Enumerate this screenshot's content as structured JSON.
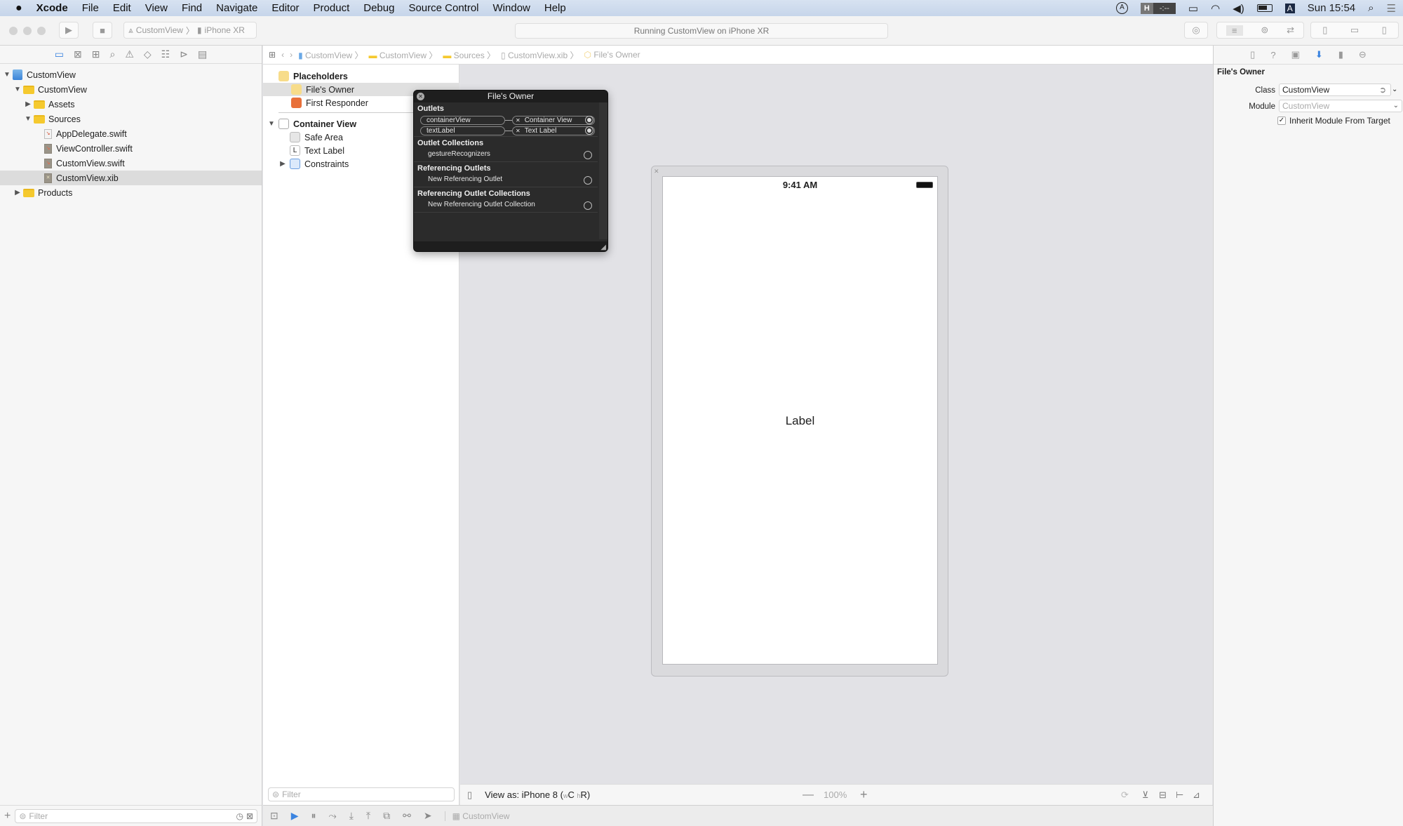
{
  "menubar": {
    "apple": "",
    "app": "Xcode",
    "items": [
      "File",
      "Edit",
      "View",
      "Find",
      "Navigate",
      "Editor",
      "Product",
      "Debug",
      "Source Control",
      "Window",
      "Help"
    ],
    "status": {
      "input_badge": "H",
      "timer": "-:--",
      "keyboard": "A",
      "clock": "Sun 15:54"
    }
  },
  "toolbar": {
    "scheme": "CustomView",
    "device": "iPhone XR",
    "activity": "Running CustomView on iPhone XR"
  },
  "navigator": {
    "tree": [
      {
        "label": "CustomView",
        "level": 0,
        "kind": "project",
        "open": true
      },
      {
        "label": "CustomView",
        "level": 1,
        "kind": "folder",
        "open": true
      },
      {
        "label": "Assets",
        "level": 2,
        "kind": "folder",
        "open": false
      },
      {
        "label": "Sources",
        "level": 2,
        "kind": "folder",
        "open": true
      },
      {
        "label": "AppDelegate.swift",
        "level": 3,
        "kind": "swift"
      },
      {
        "label": "ViewController.swift",
        "level": 3,
        "kind": "swift"
      },
      {
        "label": "CustomView.swift",
        "level": 3,
        "kind": "swift"
      },
      {
        "label": "CustomView.xib",
        "level": 3,
        "kind": "xib",
        "selected": true
      },
      {
        "label": "Products",
        "level": 1,
        "kind": "folder",
        "open": false
      }
    ],
    "filter_placeholder": "Filter"
  },
  "jumpbar": [
    "CustomView",
    "CustomView",
    "Sources",
    "CustomView.xib",
    "File's Owner"
  ],
  "outline": {
    "placeholders": "Placeholders",
    "files_owner": "File's Owner",
    "first_responder": "First Responder",
    "container_view": "Container View",
    "safe_area": "Safe Area",
    "text_label": "Text Label",
    "text_label_glyph": "L",
    "constraints": "Constraints",
    "filter_placeholder": "Filter"
  },
  "popover": {
    "title": "File's Owner",
    "outlets_header": "Outlets",
    "outlets": [
      {
        "name": "containerView",
        "target": "Container View",
        "connected": true
      },
      {
        "name": "textLabel",
        "target": "Text Label",
        "connected": true
      }
    ],
    "collections_header": "Outlet Collections",
    "collections": [
      "gestureRecognizers"
    ],
    "ref_header": "Referencing Outlets",
    "ref_item": "New Referencing Outlet",
    "refcol_header": "Referencing Outlet Collections",
    "refcol_item": "New Referencing Outlet Collection"
  },
  "device": {
    "time": "9:41 AM",
    "label": "Label"
  },
  "canvasbar": {
    "view_as": "View as: iPhone 8 (",
    "w": "w",
    "c": "C ",
    "h": "h",
    "r": "R)",
    "zoom": "100%"
  },
  "debugbar": {
    "process": "CustomView"
  },
  "inspector": {
    "title": "File's Owner",
    "class_label": "Class",
    "class_value": "CustomView",
    "module_label": "Module",
    "module_placeholder": "CustomView",
    "inherit_label": "Inherit Module From Target",
    "inherit_checked": true
  }
}
